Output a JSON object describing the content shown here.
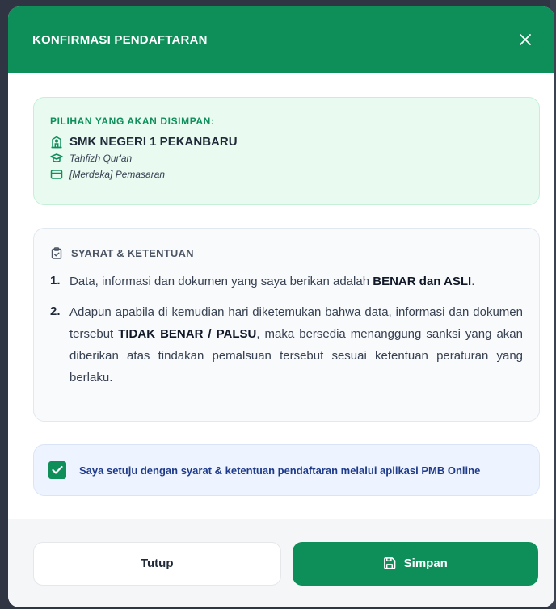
{
  "modal": {
    "title": "KONFIRMASI PENDAFTARAN"
  },
  "selection": {
    "heading": "PILIHAN YANG AKAN DISIMPAN:",
    "school": "SMK NEGERI 1 PEKANBARU",
    "program": "Tahfizh Qur'an",
    "major": "[Merdeka] Pemasaran"
  },
  "terms": {
    "heading": "SYARAT & KETENTUAN",
    "items": [
      {
        "num": "1.",
        "before": "Data, informasi dan dokumen yang saya berikan adalah ",
        "bold": "BENAR dan ASLI",
        "after": "."
      },
      {
        "num": "2.",
        "before": "Adapun apabila di kemudian hari diketemukan bahwa data, informasi dan dokumen tersebut ",
        "bold": "TIDAK BENAR / PALSU",
        "after": ", maka bersedia menanggung sanksi yang akan diberikan atas tindakan pemalsuan tersebut sesuai ketentuan peraturan yang berlaku."
      }
    ]
  },
  "agreement": {
    "checked": true,
    "label": "Saya setuju dengan syarat & ketentuan pendaftaran melalui aplikasi PMB Online"
  },
  "footer": {
    "close_label": "Tutup",
    "save_label": "Simpan"
  },
  "colors": {
    "primary": "#0e8f5a",
    "agree_text": "#1e3a8a"
  },
  "icons": {
    "close": "close-icon",
    "school": "school-icon",
    "program": "graduation-cap-icon",
    "major": "card-icon",
    "terms": "clipboard-check-icon",
    "checkbox": "check-icon",
    "save": "save-icon"
  }
}
